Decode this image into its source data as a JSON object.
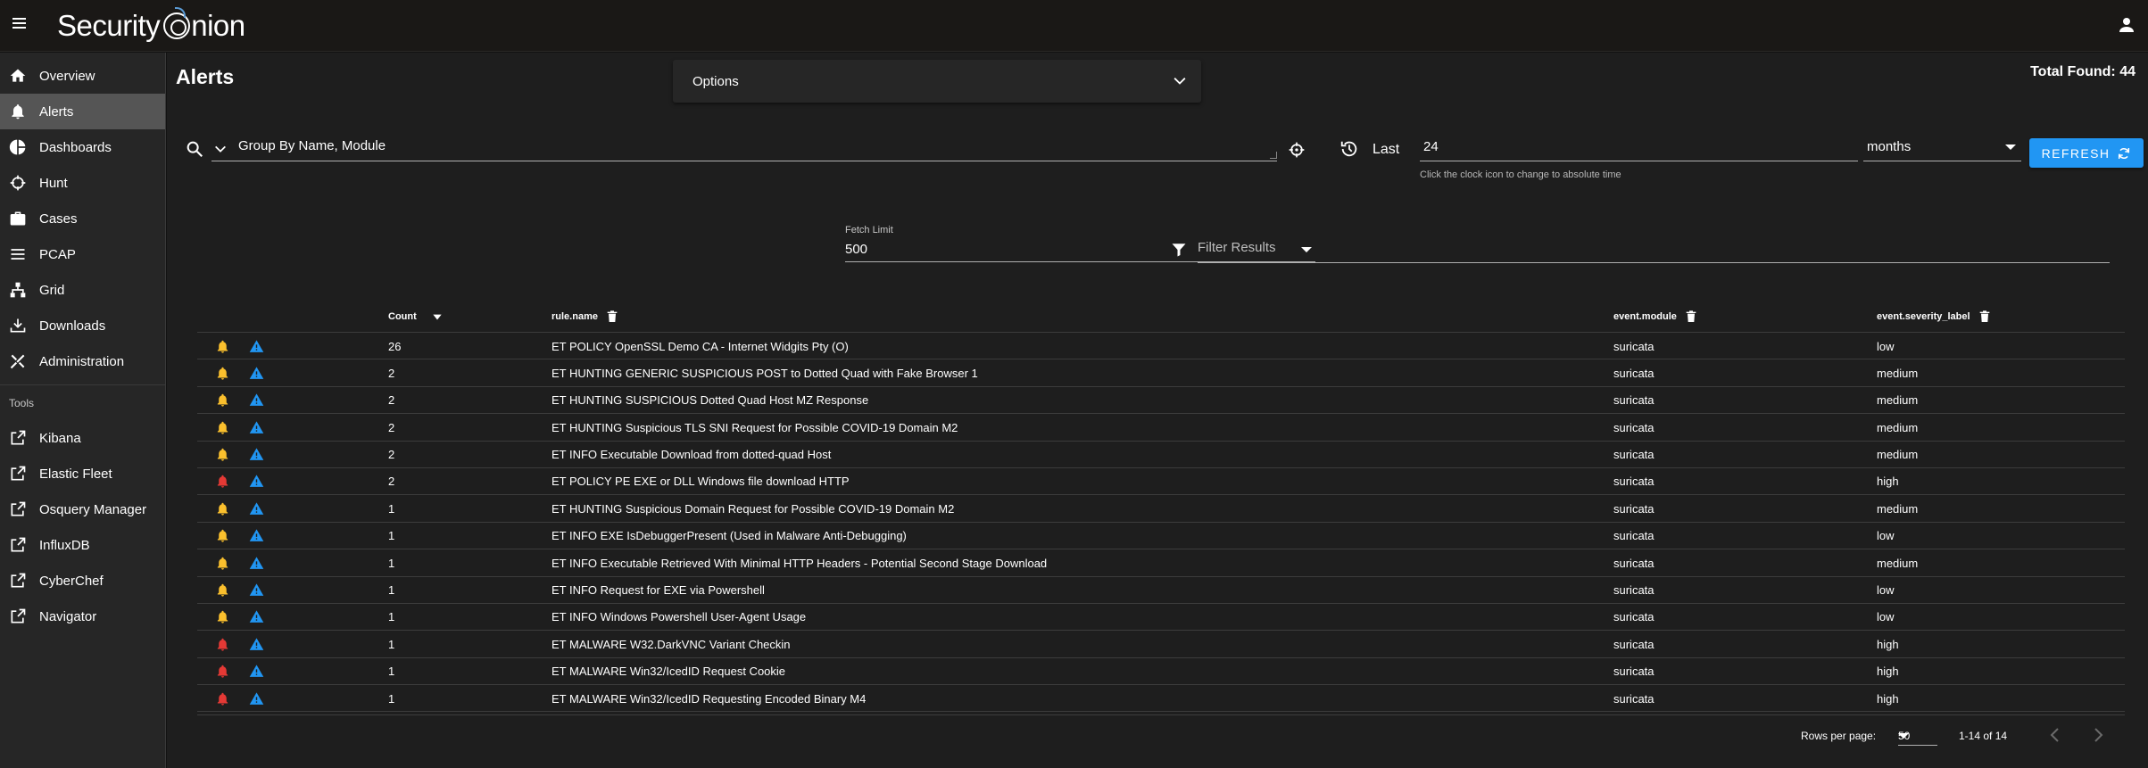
{
  "app": {
    "logo_text_1": "Security",
    "logo_text_2": "nion"
  },
  "sidebar": {
    "items": [
      {
        "label": "Overview",
        "icon": "home-icon"
      },
      {
        "label": "Alerts",
        "icon": "bell-icon",
        "active": true
      },
      {
        "label": "Dashboards",
        "icon": "chart-pie-icon"
      },
      {
        "label": "Hunt",
        "icon": "crosshairs-icon"
      },
      {
        "label": "Cases",
        "icon": "briefcase-icon"
      },
      {
        "label": "PCAP",
        "icon": "list-icon"
      },
      {
        "label": "Grid",
        "icon": "network-icon"
      },
      {
        "label": "Downloads",
        "icon": "download-icon"
      },
      {
        "label": "Administration",
        "icon": "tools-icon"
      }
    ],
    "tools_heading": "Tools",
    "tools": [
      {
        "label": "Kibana",
        "icon": "external-link-icon"
      },
      {
        "label": "Elastic Fleet",
        "icon": "external-link-icon"
      },
      {
        "label": "Osquery Manager",
        "icon": "external-link-icon"
      },
      {
        "label": "InfluxDB",
        "icon": "external-link-icon"
      },
      {
        "label": "CyberChef",
        "icon": "external-link-icon"
      },
      {
        "label": "Navigator",
        "icon": "external-link-icon"
      }
    ]
  },
  "page": {
    "title": "Alerts",
    "total_found": "Total Found: 44",
    "options_label": "Options"
  },
  "query": {
    "value": "Group By Name, Module",
    "last_label": "Last",
    "last_value": "24",
    "last_hint": "Click the clock icon to change to absolute time",
    "units": "months",
    "refresh_label": "REFRESH"
  },
  "filters": {
    "fetch_limit_label": "Fetch Limit",
    "fetch_limit_value": "500",
    "filter_placeholder": "Filter Results"
  },
  "table": {
    "headers": {
      "count": "Count",
      "rule": "rule.name",
      "module": "event.module",
      "severity": "event.severity_label"
    },
    "rows": [
      {
        "count": "26",
        "rule": "ET POLICY OpenSSL Demo CA - Internet Widgits Pty (O)",
        "module": "suricata",
        "severity": "low"
      },
      {
        "count": "2",
        "rule": "ET HUNTING GENERIC SUSPICIOUS POST to Dotted Quad with Fake Browser 1",
        "module": "suricata",
        "severity": "medium"
      },
      {
        "count": "2",
        "rule": "ET HUNTING SUSPICIOUS Dotted Quad Host MZ Response",
        "module": "suricata",
        "severity": "medium"
      },
      {
        "count": "2",
        "rule": "ET HUNTING Suspicious TLS SNI Request for Possible COVID-19 Domain M2",
        "module": "suricata",
        "severity": "medium"
      },
      {
        "count": "2",
        "rule": "ET INFO Executable Download from dotted-quad Host",
        "module": "suricata",
        "severity": "medium"
      },
      {
        "count": "2",
        "rule": "ET POLICY PE EXE or DLL Windows file download HTTP",
        "module": "suricata",
        "severity": "high"
      },
      {
        "count": "1",
        "rule": "ET HUNTING Suspicious Domain Request for Possible COVID-19 Domain M2",
        "module": "suricata",
        "severity": "medium"
      },
      {
        "count": "1",
        "rule": "ET INFO EXE IsDebuggerPresent (Used in Malware Anti-Debugging)",
        "module": "suricata",
        "severity": "low"
      },
      {
        "count": "1",
        "rule": "ET INFO Executable Retrieved With Minimal HTTP Headers - Potential Second Stage Download",
        "module": "suricata",
        "severity": "medium"
      },
      {
        "count": "1",
        "rule": "ET INFO Request for EXE via Powershell",
        "module": "suricata",
        "severity": "low"
      },
      {
        "count": "1",
        "rule": "ET INFO Windows Powershell User-Agent Usage",
        "module": "suricata",
        "severity": "low"
      },
      {
        "count": "1",
        "rule": "ET MALWARE W32.DarkVNC Variant Checkin",
        "module": "suricata",
        "severity": "high"
      },
      {
        "count": "1",
        "rule": "ET MALWARE Win32/IcedID Request Cookie",
        "module": "suricata",
        "severity": "high"
      },
      {
        "count": "1",
        "rule": "ET MALWARE Win32/IcedID Requesting Encoded Binary M4",
        "module": "suricata",
        "severity": "high"
      }
    ]
  },
  "pagination": {
    "rows_per_page_label": "Rows per page:",
    "rows_per_page": "50",
    "range": "1-14 of 14"
  },
  "colors": {
    "accent": "#2196f3",
    "bell_yellow": "#fbc02d",
    "bell_red": "#e53935",
    "warning_blue": "#2196f3"
  }
}
